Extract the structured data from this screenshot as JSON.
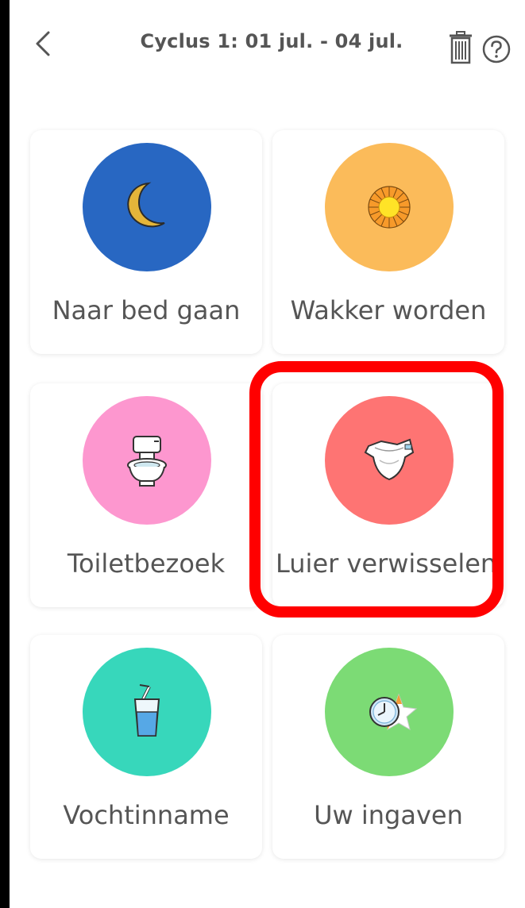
{
  "header": {
    "title": "Cyclus 1: 01 jul. - 04 jul.",
    "back_icon": "chevron-left-icon",
    "trash_icon": "trash-icon",
    "help_icon": "question-mark-icon"
  },
  "tiles": [
    {
      "label": "Naar bed gaan",
      "icon": "moon-icon",
      "color": "#2867c2"
    },
    {
      "label": "Wakker worden",
      "icon": "sun-icon",
      "color": "#fbbb5a"
    },
    {
      "label": "Toiletbezoek",
      "icon": "toilet-icon",
      "color": "#fd97cf"
    },
    {
      "label": "Luier verwisselen",
      "icon": "diaper-icon",
      "color": "#fe7473"
    },
    {
      "label": "Vochtinname",
      "icon": "drink-glass-icon",
      "color": "#37d7bb"
    },
    {
      "label": "Uw ingaven",
      "icon": "clock-star-icon",
      "color": "#7cdb75"
    }
  ],
  "highlight_color": "#ff0000"
}
